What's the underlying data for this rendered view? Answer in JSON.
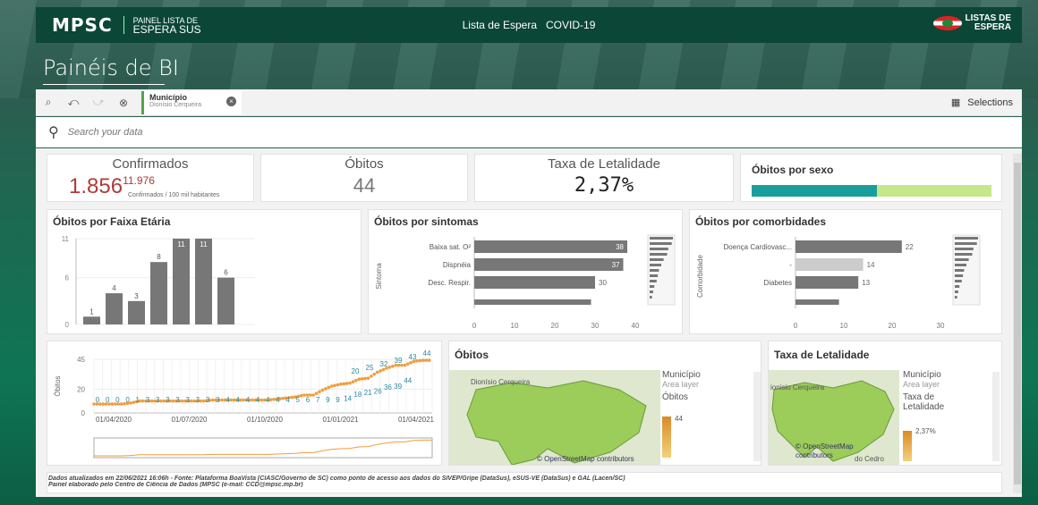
{
  "header": {
    "logo": "MPSC",
    "logo_sub_1": "PAINEL LISTA DE",
    "logo_sub_2": "ESPERA SUS",
    "nav_1": "Lista de Espera",
    "nav_2": "COVID-19",
    "brand_1": "LISTAS DE",
    "brand_2": "ESPERA"
  },
  "page": {
    "title": "Painéis de BI"
  },
  "selection": {
    "field": "Município",
    "value": "Dionísio Cerqueira",
    "selections_label": "Selections"
  },
  "search": {
    "placeholder": "Search your data"
  },
  "kpis": {
    "confirmados": {
      "title": "Confirmados",
      "value": "1.856",
      "per_rate": "11.976",
      "per_label": "Confirmados / 100 mil habitantes"
    },
    "obitos": {
      "title": "Óbitos",
      "value": "44"
    },
    "letalidade": {
      "title": "Taxa de Letalidade",
      "value": "2,37%"
    },
    "sexo": {
      "title": "Óbitos por sexo",
      "colors": [
        "#1a9e9c",
        "#c4e88a"
      ]
    }
  },
  "colors": {
    "bar": "#777777",
    "bar_light": "#cccccc",
    "accent_red": "#b13b3b",
    "line_orange": "#f39c3c",
    "map_green": "#9ccc5a"
  },
  "charts": {
    "faixa": {
      "title": "Óbitos por Faixa Etária"
    },
    "sintomas": {
      "title": "Óbitos por sintomas",
      "ylabel": "Sintoma"
    },
    "comorb": {
      "title": "Óbitos por comorbidades",
      "ylabel": "Comorbidade"
    },
    "timeline": {
      "ylabel": "Óbitos"
    }
  },
  "chart_data": [
    {
      "type": "bar",
      "title": "Óbitos por Faixa Etária",
      "values": [
        1,
        4,
        3,
        8,
        11,
        11,
        6
      ],
      "yticks": [
        0,
        6,
        11
      ],
      "ylim": [
        0,
        11
      ]
    },
    {
      "type": "bar",
      "title": "Óbitos por sintomas",
      "ylabel": "Sintoma",
      "orientation": "horizontal",
      "categories": [
        "Baixa sat. O²",
        "Dispnéia",
        "Desc. Respir.",
        ""
      ],
      "values": [
        38,
        37,
        30,
        29
      ],
      "xticks": [
        0,
        10,
        20,
        30,
        40
      ],
      "xlim": [
        0,
        40
      ]
    },
    {
      "type": "bar",
      "title": "Óbitos por comorbidades",
      "ylabel": "Comorbidade",
      "orientation": "horizontal",
      "categories": [
        "Doença Cardiovasc...",
        "-",
        "Diabetes",
        ""
      ],
      "values": [
        22,
        14,
        13,
        9
      ],
      "xticks": [
        0,
        10,
        20,
        30
      ],
      "xlim": [
        0,
        30
      ]
    },
    {
      "type": "line",
      "ylabel": "Óbitos",
      "yticks": [
        0,
        20,
        45
      ],
      "ylim": [
        0,
        45
      ],
      "xticks": [
        "01/04/2020",
        "01/07/2020",
        "01/10/2020",
        "01/01/2021",
        "01/04/2021"
      ],
      "labels_low": [
        "0",
        "0",
        "0",
        "0",
        "1",
        "3",
        "3",
        "3",
        "3",
        "3",
        "3",
        "3",
        "3",
        "4",
        "4",
        "4",
        "4",
        "4",
        "4",
        "4",
        "5",
        "6",
        "7",
        "9",
        "9",
        "14",
        "18",
        "21",
        "26",
        "36",
        "39",
        "44"
      ],
      "labels_high": [
        "20",
        "25",
        "32",
        "39",
        "43",
        "44"
      ],
      "values": [
        0,
        0,
        0,
        0,
        1,
        3,
        3,
        3,
        3,
        3,
        3,
        3,
        3,
        4,
        4,
        4,
        4,
        4,
        4,
        4,
        5,
        6,
        7,
        9,
        9,
        14,
        18,
        20,
        21,
        25,
        26,
        32,
        36,
        39,
        39,
        43,
        44,
        44
      ]
    }
  ],
  "maps": {
    "obitos": {
      "title": "Óbitos",
      "place": "Dionísio Cerqueira",
      "legend_title": "Município",
      "legend_sub": "Area layer",
      "measure": "Óbitos",
      "measure_value": "44",
      "attribution": "© OpenStreetMap contributors"
    },
    "letalidade": {
      "title": "Taxa de Letalidade",
      "place": "ionisio Cerqueira",
      "legend_title": "Município",
      "legend_sub": "Area layer",
      "measure_1": "Taxa de",
      "measure_2": "Letalidade",
      "measure_value": "2,37%",
      "attribution_1": "© OpenStreetMap",
      "attribution_2": "contributors",
      "place_2": "do Cedro"
    }
  },
  "footer": {
    "note_1": "Dados atualizados em 22/06/2021 16:06h - Fonte: Plataforma BoaVista (CIASC/Governo de SC) como ponto de acesso aos dados do SIVEP/Gripe (DataSus), eSUS-VE (DataSus) e GAL (Lacen/SC)",
    "note_2": "Painel elaborado pelo Centro de Ciência de Dados (MPSC (e-mail: CCD@mpsc.mp.br)"
  }
}
